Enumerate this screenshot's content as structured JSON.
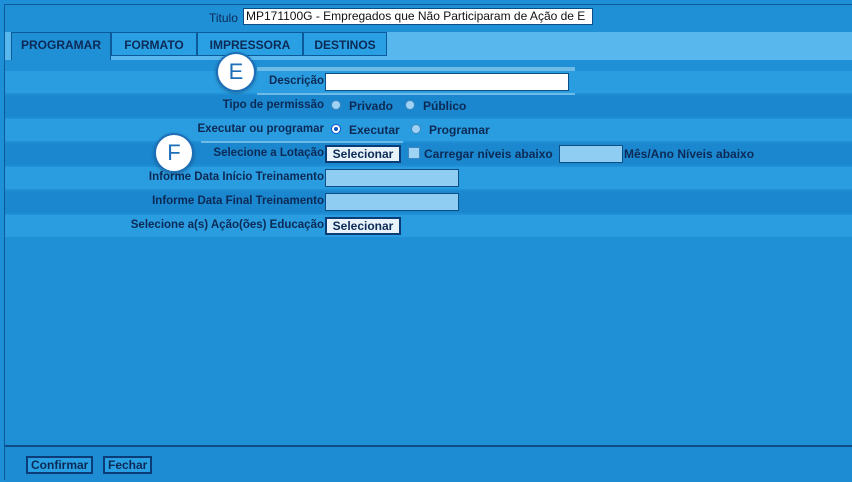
{
  "header": {
    "title_label": "Titulo",
    "title_value": "MP171100G - Empregados que Não Participaram de Ação de E"
  },
  "tabs": [
    {
      "label": "PROGRAMAR",
      "active": true
    },
    {
      "label": "FORMATO",
      "active": false
    },
    {
      "label": "IMPRESSORA",
      "active": false
    },
    {
      "label": "DESTINOS",
      "active": false
    }
  ],
  "form": {
    "descricao_label": "Descrição",
    "descricao_value": "",
    "permissao_label": "Tipo de permissão",
    "permissao_options": [
      "Privado",
      "Público"
    ],
    "permissao_selected": "",
    "executar_label": "Executar ou programar",
    "executar_options": [
      "Executar",
      "Programar"
    ],
    "executar_selected": "Executar",
    "lotacao_label": "Selecione a Lotação",
    "lotacao_button": "Selecionar",
    "carregar_label": "Carregar níveis abaixo",
    "carregar_checked": false,
    "niveis_value": "",
    "niveis_suffix": "Mês/Ano Níveis abaixo",
    "data_inicio_label": "Informe Data Início Treinamento",
    "data_inicio_value": "",
    "data_final_label": "Informe Data Final Treinamento",
    "data_final_value": "",
    "acoes_label": "Selecione a(s) Ação(ões) Educação",
    "acoes_button": "Selecionar"
  },
  "markers": {
    "e": "E",
    "f": "F"
  },
  "footer": {
    "confirm_label": "Confirmar",
    "close_label": "Fechar"
  },
  "colors": {
    "background": "#1f8fd6",
    "tab_strip": "#58b8ee",
    "highlight": "#7ec3ea",
    "marker_accent": "#1c6fb8"
  }
}
